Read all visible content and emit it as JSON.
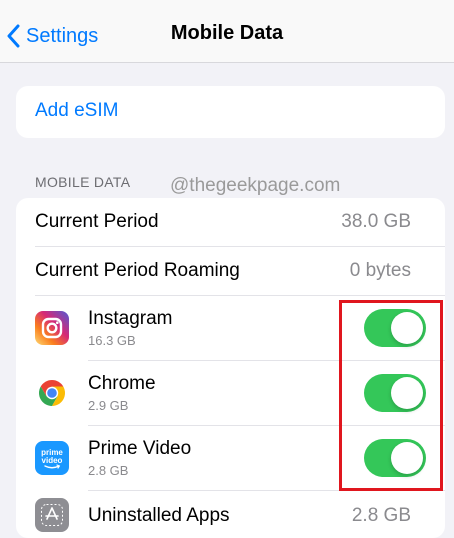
{
  "nav": {
    "back_label": "Settings",
    "title": "Mobile Data"
  },
  "esim": {
    "label": "Add eSIM"
  },
  "section": {
    "header": "MOBILE DATA"
  },
  "watermark": "@thegeekpage.com",
  "stats": [
    {
      "label": "Current Period",
      "value": "38.0 GB"
    },
    {
      "label": "Current Period Roaming",
      "value": "0 bytes"
    }
  ],
  "apps": [
    {
      "name": "Instagram",
      "usage": "16.3 GB",
      "icon": "instagram-icon",
      "enabled": true
    },
    {
      "name": "Chrome",
      "usage": "2.9 GB",
      "icon": "chrome-icon",
      "enabled": true
    },
    {
      "name": "Prime Video",
      "usage": "2.8 GB",
      "icon": "prime-video-icon",
      "icon_text": [
        "prime",
        "video"
      ],
      "enabled": true
    }
  ],
  "uninstalled": {
    "label": "Uninstalled Apps",
    "value": "2.8 GB",
    "icon": "app-store-icon"
  },
  "colors": {
    "accent": "#007aff",
    "toggle_on": "#34c759",
    "highlight": "#e0161e"
  }
}
